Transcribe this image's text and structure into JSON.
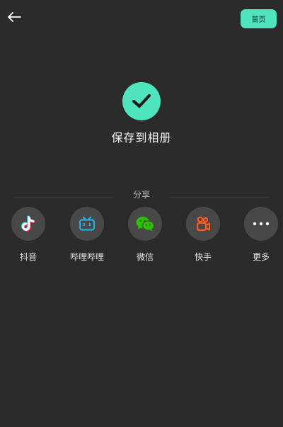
{
  "header": {
    "back_icon": "arrow-left-icon",
    "home_label": "首页"
  },
  "colors": {
    "accent": "#4fe3be",
    "background": "#2b2b2b",
    "share_circle": "#484848",
    "douyin_red": "#fe2c55",
    "douyin_cyan": "#25f4ee",
    "bilibili_blue": "#23ade5",
    "wechat_green": "#2dc100",
    "kuaishou_orange": "#ff5a1f"
  },
  "status": {
    "icon": "check-icon",
    "message": "保存到相册"
  },
  "share": {
    "label": "分享",
    "items": [
      {
        "name": "抖音",
        "icon": "douyin-icon"
      },
      {
        "name": "哔哩哔哩",
        "icon": "bilibili-icon"
      },
      {
        "name": "微信",
        "icon": "wechat-icon"
      },
      {
        "name": "快手",
        "icon": "kuaishou-icon"
      },
      {
        "name": "更多",
        "icon": "more-icon"
      }
    ]
  }
}
